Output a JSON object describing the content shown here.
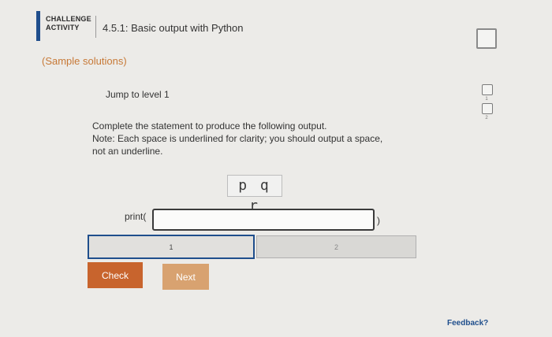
{
  "header": {
    "badge_line1": "CHALLENGE",
    "badge_line2": "ACTIVITY",
    "title": "4.5.1: Basic output with Python"
  },
  "sample_solutions_label": "(Sample solutions)",
  "levels": [
    {
      "number": "1"
    },
    {
      "number": "2"
    }
  ],
  "jump_label": "Jump to level 1",
  "instructions": {
    "line1": "Complete the statement to produce the following output.",
    "line2": "Note: Each space is underlined for clarity; you should output a space,",
    "line3": "not an underline."
  },
  "expected_output": "p q r",
  "code": {
    "prefix": "print(",
    "input_value": "",
    "suffix": ")"
  },
  "progress": {
    "segments": [
      {
        "label": "1",
        "active": true
      },
      {
        "label": "2",
        "active": false
      }
    ]
  },
  "buttons": {
    "check": "Check",
    "next": "Next"
  },
  "feedback_label": "Feedback?",
  "colors": {
    "accent_blue": "#1f4e8c",
    "check_orange": "#c8642d",
    "next_tan": "#d8a270",
    "sample_link": "#c77937"
  }
}
